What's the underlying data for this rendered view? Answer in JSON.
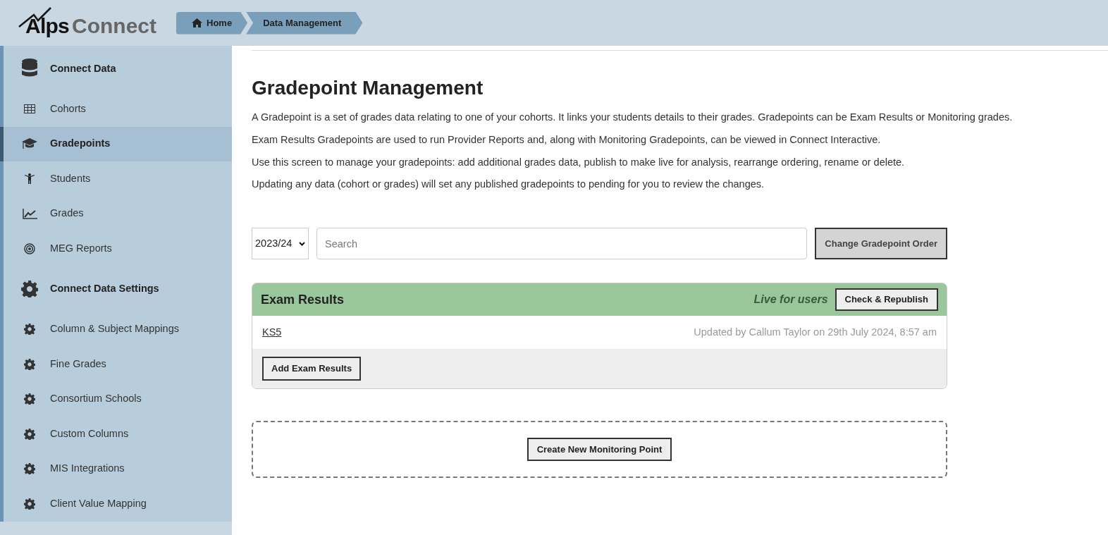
{
  "logo": {
    "part_1": "Alps",
    "part_2": "Connect"
  },
  "breadcrumb": [
    {
      "label": "Home",
      "kind": "home"
    },
    {
      "label": "Data Management",
      "kind": "page"
    }
  ],
  "sidebar": {
    "items": [
      {
        "label": "Connect Data",
        "kind": "header"
      },
      {
        "label": "Cohorts",
        "kind": "item",
        "selected": false
      },
      {
        "label": "Gradepoints",
        "kind": "item",
        "selected": true
      },
      {
        "label": "Students",
        "kind": "item",
        "selected": false
      },
      {
        "label": "Grades",
        "kind": "item",
        "selected": false
      },
      {
        "label": "MEG Reports",
        "kind": "item",
        "selected": false
      },
      {
        "label": "Connect Data Settings",
        "kind": "header"
      },
      {
        "label": "Column & Subject Mappings",
        "kind": "item",
        "selected": false
      },
      {
        "label": "Fine Grades",
        "kind": "item",
        "selected": false
      },
      {
        "label": "Consortium Schools",
        "kind": "item",
        "selected": false
      },
      {
        "label": "Custom Columns",
        "kind": "item",
        "selected": false
      },
      {
        "label": "MIS Integrations",
        "kind": "item",
        "selected": false
      },
      {
        "label": "Client Value Mapping",
        "kind": "item",
        "selected": false
      }
    ]
  },
  "page": {
    "title": "Gradepoint Management",
    "paragraphs": [
      "A Gradepoint is a set of grades data relating to one of your cohorts. It links your students details to their grades. Gradepoints can be Exam Results or Monitoring grades.",
      "Exam Results Gradepoints are used to run Provider Reports and, along with Monitoring Gradepoints, can be viewed in Connect Interactive.",
      "Use this screen to manage your gradepoints: add additional grades data, publish to make live for analysis, rearrange ordering, rename or delete.",
      "Updating any data (cohort or grades) will set any published gradepoints to pending for you to review the changes."
    ]
  },
  "toolbar": {
    "year": "2023/24",
    "search_placeholder": "Search",
    "order_button": "Change Gradepoint Order"
  },
  "exam_results": {
    "title": "Exam Results",
    "status": "Live for users",
    "republish_button": "Check & Republish",
    "rows": [
      {
        "name": "KS5",
        "updated": "Updated by Callum Taylor on 29th July 2024, 8:57 am"
      }
    ],
    "add_button": "Add Exam Results"
  },
  "create_button": "Create New Monitoring Point"
}
